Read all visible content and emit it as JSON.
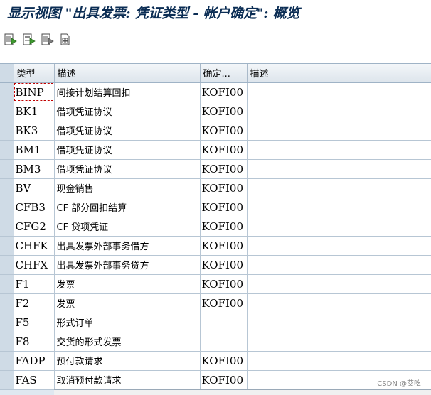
{
  "title": "显示视图 \"出具发票: 凭证类型 - 帐户确定\": 概览",
  "toolbar": {
    "buttons": [
      {
        "name": "details-icon"
      },
      {
        "name": "copy-icon"
      },
      {
        "name": "delimit-icon"
      },
      {
        "name": "select-all-icon"
      }
    ]
  },
  "columns": {
    "type": "类型",
    "desc": "描述",
    "acct": "确定...",
    "desc2": "描述"
  },
  "rows": [
    {
      "type": "BINP",
      "desc": "间接计划结算回扣",
      "acct": "KOFI00",
      "desc2": ""
    },
    {
      "type": "BK1",
      "desc": "借项凭证协议",
      "acct": "KOFI00",
      "desc2": ""
    },
    {
      "type": "BK3",
      "desc": "借项凭证协议",
      "acct": "KOFI00",
      "desc2": ""
    },
    {
      "type": "BM1",
      "desc": "借项凭证协议",
      "acct": "KOFI00",
      "desc2": ""
    },
    {
      "type": "BM3",
      "desc": "借项凭证协议",
      "acct": "KOFI00",
      "desc2": ""
    },
    {
      "type": "BV",
      "desc": "现金销售",
      "acct": "KOFI00",
      "desc2": ""
    },
    {
      "type": "CFB3",
      "desc": "CF 部分回扣结算",
      "acct": "KOFI00",
      "desc2": ""
    },
    {
      "type": "CFG2",
      "desc": "CF 贷项凭证",
      "acct": "KOFI00",
      "desc2": ""
    },
    {
      "type": "CHFK",
      "desc": "出具发票外部事务借方",
      "acct": "KOFI00",
      "desc2": ""
    },
    {
      "type": "CHFX",
      "desc": "出具发票外部事务贷方",
      "acct": "KOFI00",
      "desc2": ""
    },
    {
      "type": "F1",
      "desc": "发票",
      "acct": "KOFI00",
      "desc2": ""
    },
    {
      "type": "F2",
      "desc": "发票",
      "acct": "KOFI00",
      "desc2": ""
    },
    {
      "type": "F5",
      "desc": "形式订单",
      "acct": "",
      "desc2": ""
    },
    {
      "type": "F8",
      "desc": "交货的形式发票",
      "acct": "",
      "desc2": ""
    },
    {
      "type": "FADP",
      "desc": "预付款请求",
      "acct": "KOFI00",
      "desc2": ""
    },
    {
      "type": "FAS",
      "desc": "取消预付款请求",
      "acct": "KOFI00",
      "desc2": ""
    }
  ],
  "watermark": "CSDN @艾吆"
}
